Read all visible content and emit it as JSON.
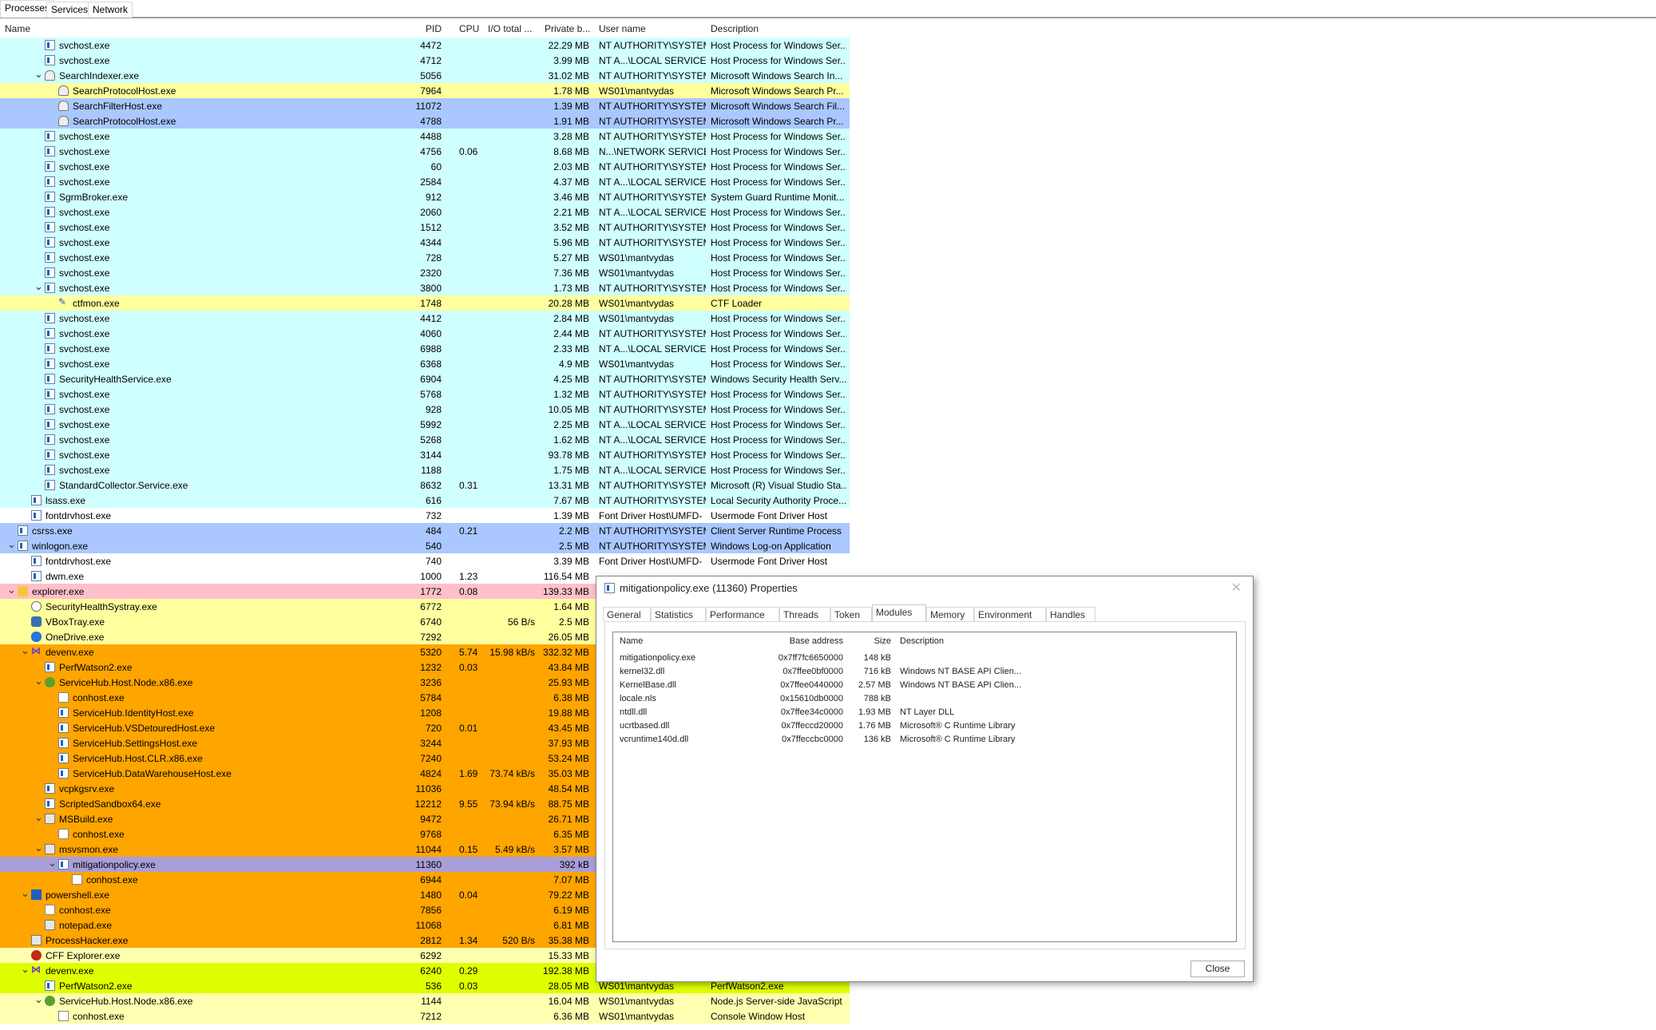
{
  "tabs": [
    "Processes",
    "Services",
    "Network"
  ],
  "columns": {
    "name": "Name",
    "pid": "PID",
    "cpu": "CPU",
    "io": "I/O total ...",
    "priv": "Private b...",
    "user": "User name",
    "desc": "Description"
  },
  "colors": {
    "cyan": "#d0ffff",
    "yellow": "#ffff9e",
    "blue": "#aac8ff",
    "white": "#ffffff",
    "pink": "#ffc0cb",
    "orange": "#ffa500",
    "purple": "#a99ed8",
    "lime": "#dfff00",
    "lightyellow": "#ffffb0"
  },
  "rows": [
    {
      "name": "svchost.exe",
      "level": 2,
      "icon": "exe",
      "pid": "4472",
      "cpu": "",
      "io": "",
      "priv": "22.29 MB",
      "user": "NT AUTHORITY\\SYSTEM",
      "desc": "Host Process for Windows Ser...",
      "color": "cyan"
    },
    {
      "name": "svchost.exe",
      "level": 2,
      "icon": "exe",
      "pid": "4712",
      "cpu": "",
      "io": "",
      "priv": "3.99 MB",
      "user": "NT A...\\LOCAL SERVICE",
      "desc": "Host Process for Windows Ser...",
      "color": "cyan"
    },
    {
      "name": "SearchIndexer.exe",
      "level": 2,
      "expanded": true,
      "icon": "search",
      "pid": "5056",
      "cpu": "",
      "io": "",
      "priv": "31.02 MB",
      "user": "NT AUTHORITY\\SYSTEM",
      "desc": "Microsoft Windows Search In...",
      "color": "cyan"
    },
    {
      "name": "SearchProtocolHost.exe",
      "level": 3,
      "icon": "search",
      "pid": "7964",
      "cpu": "",
      "io": "",
      "priv": "1.78 MB",
      "user": "WS01\\mantvydas",
      "desc": "Microsoft Windows Search Pr...",
      "color": "yellow"
    },
    {
      "name": "SearchFilterHost.exe",
      "level": 3,
      "icon": "search",
      "pid": "11072",
      "cpu": "",
      "io": "",
      "priv": "1.39 MB",
      "user": "NT AUTHORITY\\SYSTEM",
      "desc": "Microsoft Windows Search Fil...",
      "color": "blue"
    },
    {
      "name": "SearchProtocolHost.exe",
      "level": 3,
      "icon": "search",
      "pid": "4788",
      "cpu": "",
      "io": "",
      "priv": "1.91 MB",
      "user": "NT AUTHORITY\\SYSTEM",
      "desc": "Microsoft Windows Search Pr...",
      "color": "blue"
    },
    {
      "name": "svchost.exe",
      "level": 2,
      "icon": "exe",
      "pid": "4488",
      "cpu": "",
      "io": "",
      "priv": "3.28 MB",
      "user": "NT AUTHORITY\\SYSTEM",
      "desc": "Host Process for Windows Ser...",
      "color": "cyan"
    },
    {
      "name": "svchost.exe",
      "level": 2,
      "icon": "exe",
      "pid": "4756",
      "cpu": "0.06",
      "io": "",
      "priv": "8.68 MB",
      "user": "N...\\NETWORK SERVICE",
      "desc": "Host Process for Windows Ser...",
      "color": "cyan"
    },
    {
      "name": "svchost.exe",
      "level": 2,
      "icon": "exe",
      "pid": "60",
      "cpu": "",
      "io": "",
      "priv": "2.03 MB",
      "user": "NT AUTHORITY\\SYSTEM",
      "desc": "Host Process for Windows Ser...",
      "color": "cyan"
    },
    {
      "name": "svchost.exe",
      "level": 2,
      "icon": "exe",
      "pid": "2584",
      "cpu": "",
      "io": "",
      "priv": "4.37 MB",
      "user": "NT A...\\LOCAL SERVICE",
      "desc": "Host Process for Windows Ser...",
      "color": "cyan"
    },
    {
      "name": "SgrmBroker.exe",
      "level": 2,
      "icon": "exe",
      "pid": "912",
      "cpu": "",
      "io": "",
      "priv": "3.46 MB",
      "user": "NT AUTHORITY\\SYSTEM",
      "desc": "System Guard Runtime Monit...",
      "color": "cyan"
    },
    {
      "name": "svchost.exe",
      "level": 2,
      "icon": "exe",
      "pid": "2060",
      "cpu": "",
      "io": "",
      "priv": "2.21 MB",
      "user": "NT A...\\LOCAL SERVICE",
      "desc": "Host Process for Windows Ser...",
      "color": "cyan"
    },
    {
      "name": "svchost.exe",
      "level": 2,
      "icon": "exe",
      "pid": "1512",
      "cpu": "",
      "io": "",
      "priv": "3.52 MB",
      "user": "NT AUTHORITY\\SYSTEM",
      "desc": "Host Process for Windows Ser...",
      "color": "cyan"
    },
    {
      "name": "svchost.exe",
      "level": 2,
      "icon": "exe",
      "pid": "4344",
      "cpu": "",
      "io": "",
      "priv": "5.96 MB",
      "user": "NT AUTHORITY\\SYSTEM",
      "desc": "Host Process for Windows Ser...",
      "color": "cyan"
    },
    {
      "name": "svchost.exe",
      "level": 2,
      "icon": "exe",
      "pid": "728",
      "cpu": "",
      "io": "",
      "priv": "5.27 MB",
      "user": "WS01\\mantvydas",
      "desc": "Host Process for Windows Ser...",
      "color": "cyan"
    },
    {
      "name": "svchost.exe",
      "level": 2,
      "icon": "exe",
      "pid": "2320",
      "cpu": "",
      "io": "",
      "priv": "7.36 MB",
      "user": "WS01\\mantvydas",
      "desc": "Host Process for Windows Ser...",
      "color": "cyan"
    },
    {
      "name": "svchost.exe",
      "level": 2,
      "expanded": true,
      "icon": "exe",
      "pid": "3800",
      "cpu": "",
      "io": "",
      "priv": "1.73 MB",
      "user": "NT AUTHORITY\\SYSTEM",
      "desc": "Host Process for Windows Ser...",
      "color": "cyan"
    },
    {
      "name": "ctfmon.exe",
      "level": 3,
      "icon": "pen",
      "pid": "1748",
      "cpu": "",
      "io": "",
      "priv": "20.28 MB",
      "user": "WS01\\mantvydas",
      "desc": "CTF Loader",
      "color": "yellow"
    },
    {
      "name": "svchost.exe",
      "level": 2,
      "icon": "exe",
      "pid": "4412",
      "cpu": "",
      "io": "",
      "priv": "2.84 MB",
      "user": "WS01\\mantvydas",
      "desc": "Host Process for Windows Ser...",
      "color": "cyan"
    },
    {
      "name": "svchost.exe",
      "level": 2,
      "icon": "exe",
      "pid": "4060",
      "cpu": "",
      "io": "",
      "priv": "2.44 MB",
      "user": "NT AUTHORITY\\SYSTEM",
      "desc": "Host Process for Windows Ser...",
      "color": "cyan"
    },
    {
      "name": "svchost.exe",
      "level": 2,
      "icon": "exe",
      "pid": "6988",
      "cpu": "",
      "io": "",
      "priv": "2.33 MB",
      "user": "NT A...\\LOCAL SERVICE",
      "desc": "Host Process for Windows Ser...",
      "color": "cyan"
    },
    {
      "name": "svchost.exe",
      "level": 2,
      "icon": "exe",
      "pid": "6368",
      "cpu": "",
      "io": "",
      "priv": "4.9 MB",
      "user": "WS01\\mantvydas",
      "desc": "Host Process for Windows Ser...",
      "color": "cyan"
    },
    {
      "name": "SecurityHealthService.exe",
      "level": 2,
      "icon": "exe",
      "pid": "6904",
      "cpu": "",
      "io": "",
      "priv": "4.25 MB",
      "user": "NT AUTHORITY\\SYSTEM",
      "desc": "Windows Security Health Serv...",
      "color": "cyan"
    },
    {
      "name": "svchost.exe",
      "level": 2,
      "icon": "exe",
      "pid": "5768",
      "cpu": "",
      "io": "",
      "priv": "1.32 MB",
      "user": "NT AUTHORITY\\SYSTEM",
      "desc": "Host Process for Windows Ser...",
      "color": "cyan"
    },
    {
      "name": "svchost.exe",
      "level": 2,
      "icon": "exe",
      "pid": "928",
      "cpu": "",
      "io": "",
      "priv": "10.05 MB",
      "user": "NT AUTHORITY\\SYSTEM",
      "desc": "Host Process for Windows Ser...",
      "color": "cyan"
    },
    {
      "name": "svchost.exe",
      "level": 2,
      "icon": "exe",
      "pid": "5992",
      "cpu": "",
      "io": "",
      "priv": "2.25 MB",
      "user": "NT A...\\LOCAL SERVICE",
      "desc": "Host Process for Windows Ser...",
      "color": "cyan"
    },
    {
      "name": "svchost.exe",
      "level": 2,
      "icon": "exe",
      "pid": "5268",
      "cpu": "",
      "io": "",
      "priv": "1.62 MB",
      "user": "NT A...\\LOCAL SERVICE",
      "desc": "Host Process for Windows Ser...",
      "color": "cyan"
    },
    {
      "name": "svchost.exe",
      "level": 2,
      "icon": "exe",
      "pid": "3144",
      "cpu": "",
      "io": "",
      "priv": "93.78 MB",
      "user": "NT AUTHORITY\\SYSTEM",
      "desc": "Host Process for Windows Ser...",
      "color": "cyan"
    },
    {
      "name": "svchost.exe",
      "level": 2,
      "icon": "exe",
      "pid": "1188",
      "cpu": "",
      "io": "",
      "priv": "1.75 MB",
      "user": "NT A...\\LOCAL SERVICE",
      "desc": "Host Process for Windows Ser...",
      "color": "cyan"
    },
    {
      "name": "StandardCollector.Service.exe",
      "level": 2,
      "icon": "exe",
      "pid": "8632",
      "cpu": "0.31",
      "io": "",
      "priv": "13.31 MB",
      "user": "NT AUTHORITY\\SYSTEM",
      "desc": "Microsoft (R) Visual Studio Sta...",
      "color": "cyan"
    },
    {
      "name": "lsass.exe",
      "level": 1,
      "icon": "exe",
      "pid": "616",
      "cpu": "",
      "io": "",
      "priv": "7.67 MB",
      "user": "NT AUTHORITY\\SYSTEM",
      "desc": "Local Security Authority Proce...",
      "color": "cyan"
    },
    {
      "name": "fontdrvhost.exe",
      "level": 1,
      "icon": "exe",
      "pid": "732",
      "cpu": "",
      "io": "",
      "priv": "1.39 MB",
      "user": "Font Driver Host\\UMFD-",
      "desc": "Usermode Font Driver Host",
      "color": "white"
    },
    {
      "name": "csrss.exe",
      "level": 0,
      "icon": "exe",
      "pid": "484",
      "cpu": "0.21",
      "io": "",
      "priv": "2.2 MB",
      "user": "NT AUTHORITY\\SYSTEM",
      "desc": "Client Server Runtime Process",
      "color": "blue"
    },
    {
      "name": "winlogon.exe",
      "level": 0,
      "expanded": true,
      "icon": "exe",
      "pid": "540",
      "cpu": "",
      "io": "",
      "priv": "2.5 MB",
      "user": "NT AUTHORITY\\SYSTEM",
      "desc": "Windows Log-on Application",
      "color": "blue"
    },
    {
      "name": "fontdrvhost.exe",
      "level": 1,
      "icon": "exe",
      "pid": "740",
      "cpu": "",
      "io": "",
      "priv": "3.39 MB",
      "user": "Font Driver Host\\UMFD-",
      "desc": "Usermode Font Driver Host",
      "color": "white"
    },
    {
      "name": "dwm.exe",
      "level": 1,
      "icon": "exe",
      "pid": "1000",
      "cpu": "1.23",
      "io": "",
      "priv": "116.54 MB",
      "user": "",
      "desc": "",
      "color": "white"
    },
    {
      "name": "explorer.exe",
      "level": 0,
      "expanded": true,
      "icon": "folder",
      "pid": "1772",
      "cpu": "0.08",
      "io": "",
      "priv": "139.33 MB",
      "user": "",
      "desc": "",
      "color": "pink"
    },
    {
      "name": "SecurityHealthSystray.exe",
      "level": 1,
      "icon": "shield",
      "pid": "6772",
      "cpu": "",
      "io": "",
      "priv": "1.64 MB",
      "user": "",
      "desc": "",
      "color": "yellow"
    },
    {
      "name": "VBoxTray.exe",
      "level": 1,
      "icon": "vbox",
      "pid": "6740",
      "cpu": "",
      "io": "56 B/s",
      "priv": "2.5 MB",
      "user": "",
      "desc": "",
      "color": "yellow"
    },
    {
      "name": "OneDrive.exe",
      "level": 1,
      "icon": "cloud",
      "pid": "7292",
      "cpu": "",
      "io": "",
      "priv": "26.05 MB",
      "user": "",
      "desc": "",
      "color": "yellow"
    },
    {
      "name": "devenv.exe",
      "level": 1,
      "expanded": true,
      "icon": "vs",
      "pid": "5320",
      "cpu": "5.74",
      "io": "15.98 kB/s",
      "priv": "332.32 MB",
      "user": "",
      "desc": "",
      "color": "orange"
    },
    {
      "name": "PerfWatson2.exe",
      "level": 2,
      "icon": "exe",
      "pid": "1232",
      "cpu": "0.03",
      "io": "",
      "priv": "43.84 MB",
      "user": "",
      "desc": "",
      "color": "orange"
    },
    {
      "name": "ServiceHub.Host.Node.x86.exe",
      "level": 2,
      "expanded": true,
      "icon": "node",
      "pid": "3236",
      "cpu": "",
      "io": "",
      "priv": "25.93 MB",
      "user": "",
      "desc": "",
      "color": "orange"
    },
    {
      "name": "conhost.exe",
      "level": 3,
      "icon": "blank",
      "pid": "5784",
      "cpu": "",
      "io": "",
      "priv": "6.38 MB",
      "user": "",
      "desc": "",
      "color": "orange"
    },
    {
      "name": "ServiceHub.IdentityHost.exe",
      "level": 3,
      "icon": "exe",
      "pid": "1208",
      "cpu": "",
      "io": "",
      "priv": "19.88 MB",
      "user": "",
      "desc": "",
      "color": "orange"
    },
    {
      "name": "ServiceHub.VSDetouredHost.exe",
      "level": 3,
      "icon": "exe",
      "pid": "720",
      "cpu": "0.01",
      "io": "",
      "priv": "43.45 MB",
      "user": "",
      "desc": "",
      "color": "orange"
    },
    {
      "name": "ServiceHub.SettingsHost.exe",
      "level": 3,
      "icon": "exe",
      "pid": "3244",
      "cpu": "",
      "io": "",
      "priv": "37.93 MB",
      "user": "",
      "desc": "",
      "color": "orange"
    },
    {
      "name": "ServiceHub.Host.CLR.x86.exe",
      "level": 3,
      "icon": "exe",
      "pid": "7240",
      "cpu": "",
      "io": "",
      "priv": "53.24 MB",
      "user": "",
      "desc": "",
      "color": "orange"
    },
    {
      "name": "ServiceHub.DataWarehouseHost.exe",
      "level": 3,
      "icon": "exe",
      "pid": "4824",
      "cpu": "1.69",
      "io": "73.74 kB/s",
      "priv": "35.03 MB",
      "user": "",
      "desc": "",
      "color": "orange"
    },
    {
      "name": "vcpkgsrv.exe",
      "level": 2,
      "icon": "exe",
      "pid": "11036",
      "cpu": "",
      "io": "",
      "priv": "48.54 MB",
      "user": "",
      "desc": "",
      "color": "orange"
    },
    {
      "name": "ScriptedSandbox64.exe",
      "level": 2,
      "icon": "exe",
      "pid": "12212",
      "cpu": "9.55",
      "io": "73.94 kB/s",
      "priv": "88.75 MB",
      "user": "",
      "desc": "",
      "color": "orange"
    },
    {
      "name": "MSBuild.exe",
      "level": 2,
      "expanded": true,
      "icon": "other",
      "pid": "9472",
      "cpu": "",
      "io": "",
      "priv": "26.71 MB",
      "user": "",
      "desc": "",
      "color": "orange"
    },
    {
      "name": "conhost.exe",
      "level": 3,
      "icon": "blank",
      "pid": "9768",
      "cpu": "",
      "io": "",
      "priv": "6.35 MB",
      "user": "",
      "desc": "",
      "color": "orange"
    },
    {
      "name": "msvsmon.exe",
      "level": 2,
      "expanded": true,
      "icon": "other",
      "pid": "11044",
      "cpu": "0.15",
      "io": "5.49 kB/s",
      "priv": "3.57 MB",
      "user": "",
      "desc": "",
      "color": "orange"
    },
    {
      "name": "mitigationpolicy.exe",
      "level": 3,
      "expanded": true,
      "icon": "exe",
      "pid": "11360",
      "cpu": "",
      "io": "",
      "priv": "392 kB",
      "user": "",
      "desc": "",
      "color": "purple"
    },
    {
      "name": "conhost.exe",
      "level": 4,
      "icon": "blank",
      "pid": "6944",
      "cpu": "",
      "io": "",
      "priv": "7.07 MB",
      "user": "",
      "desc": "",
      "color": "orange"
    },
    {
      "name": "powershell.exe",
      "level": 1,
      "expanded": true,
      "icon": "ps",
      "pid": "1480",
      "cpu": "0.04",
      "io": "",
      "priv": "79.22 MB",
      "user": "",
      "desc": "",
      "color": "orange"
    },
    {
      "name": "conhost.exe",
      "level": 2,
      "icon": "blank",
      "pid": "7856",
      "cpu": "",
      "io": "",
      "priv": "6.19 MB",
      "user": "",
      "desc": "",
      "color": "orange"
    },
    {
      "name": "notepad.exe",
      "level": 2,
      "icon": "other",
      "pid": "11068",
      "cpu": "",
      "io": "",
      "priv": "6.81 MB",
      "user": "",
      "desc": "",
      "color": "orange"
    },
    {
      "name": "ProcessHacker.exe",
      "level": 1,
      "icon": "other",
      "pid": "2812",
      "cpu": "1.34",
      "io": "520 B/s",
      "priv": "35.38 MB",
      "user": "",
      "desc": "",
      "color": "orange"
    },
    {
      "name": "CFF Explorer.exe",
      "level": 1,
      "icon": "cff",
      "pid": "6292",
      "cpu": "",
      "io": "",
      "priv": "15.33 MB",
      "user": "",
      "desc": "",
      "color": "lightyellow"
    },
    {
      "name": "devenv.exe",
      "level": 1,
      "expanded": true,
      "icon": "vs",
      "pid": "6240",
      "cpu": "0.29",
      "io": "",
      "priv": "192.38 MB",
      "user": "",
      "desc": "",
      "color": "lime"
    },
    {
      "name": "PerfWatson2.exe",
      "level": 2,
      "icon": "exe",
      "pid": "536",
      "cpu": "0.03",
      "io": "",
      "priv": "28.05 MB",
      "user": "WS01\\mantvydas",
      "desc": "PerfWatson2.exe",
      "color": "lime"
    },
    {
      "name": "ServiceHub.Host.Node.x86.exe",
      "level": 2,
      "expanded": true,
      "icon": "node",
      "pid": "1144",
      "cpu": "",
      "io": "",
      "priv": "16.04 MB",
      "user": "WS01\\mantvydas",
      "desc": "Node.js Server-side JavaScript",
      "color": "lightyellow"
    },
    {
      "name": "conhost.exe",
      "level": 3,
      "icon": "blank",
      "pid": "7212",
      "cpu": "",
      "io": "",
      "priv": "6.36 MB",
      "user": "WS01\\mantvydas",
      "desc": "Console Window Host",
      "color": "lightyellow"
    }
  ],
  "dialog": {
    "title": "mitigationpolicy.exe (11360) Properties",
    "close_glyph": "✕",
    "tabs": [
      "General",
      "Statistics",
      "Performance",
      "Threads",
      "Token",
      "Modules",
      "Memory",
      "Environment",
      "Handles"
    ],
    "active_tab": "Modules",
    "columns": {
      "name": "Name",
      "base": "Base address",
      "size": "Size",
      "desc": "Description"
    },
    "modules": [
      {
        "name": "mitigationpolicy.exe",
        "base": "0x7ff7fc6650000",
        "size": "148 kB",
        "desc": ""
      },
      {
        "name": "kernel32.dll",
        "base": "0x7ffee0bf0000",
        "size": "716 kB",
        "desc": "Windows NT BASE API Clien..."
      },
      {
        "name": "KernelBase.dll",
        "base": "0x7ffee0440000",
        "size": "2.57 MB",
        "desc": "Windows NT BASE API Clien..."
      },
      {
        "name": "locale.nls",
        "base": "0x15610db0000",
        "size": "788 kB",
        "desc": ""
      },
      {
        "name": "ntdll.dll",
        "base": "0x7ffee34c0000",
        "size": "1.93 MB",
        "desc": "NT Layer DLL"
      },
      {
        "name": "ucrtbased.dll",
        "base": "0x7ffeccd20000",
        "size": "1.76 MB",
        "desc": "Microsoft® C Runtime Library"
      },
      {
        "name": "vcruntime140d.dll",
        "base": "0x7ffeccbc0000",
        "size": "136 kB",
        "desc": "Microsoft® C Runtime Library"
      }
    ],
    "close_button": "Close"
  }
}
